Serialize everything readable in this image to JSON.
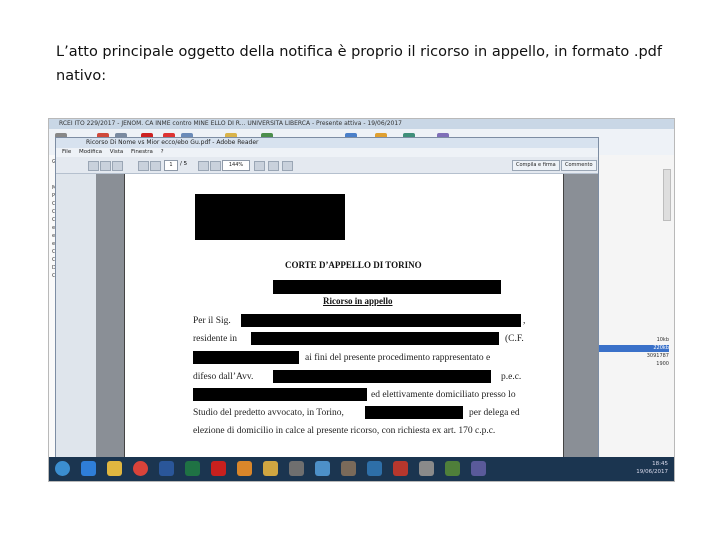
{
  "caption": "L’atto principale oggetto della notifica è proprio il ricorso in appello, in formato .pdf nativo:",
  "screenshot": {
    "outer_title": "RCEI ITO 229/2017 - JENOM. CA INME contro MINE ELLO DI R... UNIVERSITA LIBERCA - Presente attiva - 19/06/2017",
    "acrobat": {
      "title": "Ricorso Di Nome vs Mior ecco/ebo Gu.pdf - Adobe Reader",
      "menu": [
        "File",
        "Modifica",
        "Vista",
        "Finestra",
        "?"
      ],
      "page_num": "1",
      "page_total": "/ 5",
      "zoom": "144%",
      "right_buttons": [
        "Compila e firma",
        "Commento"
      ]
    },
    "document": {
      "court": "CORTE D’APPELLO DI TORINO",
      "title": "Ricorso in appello",
      "lines": [
        {
          "left": "Per il Sig.",
          "right": ","
        },
        {
          "left": "residente in",
          "right": "(C.F."
        },
        {
          "left": "",
          "right": "ai fini del presente procedimento rappresentato e"
        },
        {
          "left": "difeso dall’Avv.",
          "right": "p.e.c."
        },
        {
          "left": "",
          "right": "ed elettivamente domiciliato presso lo"
        },
        {
          "left": "Studio del predetto avvocato, in Torino,",
          "right": "per delega ed"
        },
        {
          "left": "elezione di domicilio in calce al presente ricorso, con richiesta ex art. 170 c.p.c.",
          "right": ""
        }
      ]
    },
    "left_tree": [
      "Gen",
      "Mio",
      "P",
      "Ca",
      "Ca",
      "Ca",
      "efg",
      "efg",
      "efg",
      "Ca",
      "Ca",
      "Doi",
      "Car"
    ],
    "right_list": [
      "10kb",
      "220kb",
      "3091787",
      "1900"
    ],
    "clock": {
      "time": "18:45",
      "date": "19/06/2017"
    },
    "colors": {
      "taskbar": "#1b3550",
      "selection": "#3a71c9",
      "redaction": "#000000"
    }
  }
}
